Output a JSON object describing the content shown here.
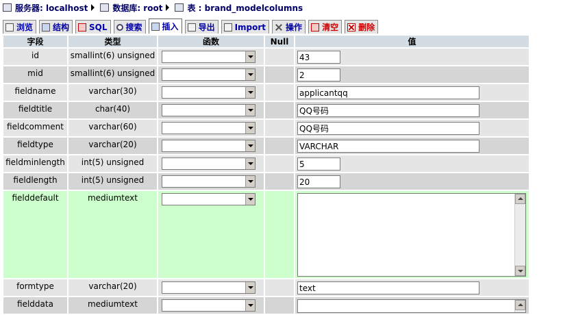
{
  "breadcrumb": {
    "server_label": "服务器: localhost",
    "database_label": "数据库: root",
    "table_label": "表 : brand_modelcolumns"
  },
  "tabs": [
    {
      "id": "browse",
      "label": "浏览",
      "icon": "browse-icon"
    },
    {
      "id": "structure",
      "label": "结构",
      "icon": "structure-icon"
    },
    {
      "id": "sql",
      "label": "SQL",
      "icon": "sql-icon"
    },
    {
      "id": "search",
      "label": "搜索",
      "icon": "search-icon"
    },
    {
      "id": "insert",
      "label": "插入",
      "icon": "insert-icon",
      "active": true
    },
    {
      "id": "export",
      "label": "导出",
      "icon": "export-icon"
    },
    {
      "id": "import",
      "label": "Import",
      "icon": "import-icon"
    },
    {
      "id": "operations",
      "label": "操作",
      "icon": "tools-icon"
    },
    {
      "id": "empty",
      "label": "清空",
      "icon": "empty-icon",
      "danger": true
    },
    {
      "id": "drop",
      "label": "删除",
      "icon": "drop-icon",
      "danger": true
    }
  ],
  "table": {
    "headers": {
      "field": "字段",
      "type": "类型",
      "function": "函数",
      "null": "Null",
      "value": "值"
    },
    "rows": [
      {
        "field": "id",
        "type": "smallint(6) unsigned",
        "value": "43"
      },
      {
        "field": "mid",
        "type": "smallint(6) unsigned",
        "value": "2"
      },
      {
        "field": "fieldname",
        "type": "varchar(30)",
        "value": "applicantqq"
      },
      {
        "field": "fieldtitle",
        "type": "char(40)",
        "value": "QQ号码"
      },
      {
        "field": "fieldcomment",
        "type": "varchar(60)",
        "value": "QQ号码"
      },
      {
        "field": "fieldtype",
        "type": "varchar(20)",
        "value": "VARCHAR"
      },
      {
        "field": "fieldminlength",
        "type": "int(5) unsigned",
        "value": "5"
      },
      {
        "field": "fieldlength",
        "type": "int(5) unsigned",
        "value": "20"
      },
      {
        "field": "fielddefault",
        "type": "mediumtext",
        "value": ""
      },
      {
        "field": "formtype",
        "type": "varchar(20)",
        "value": "text"
      },
      {
        "field": "fielddata",
        "type": "mediumtext",
        "value": ""
      }
    ]
  }
}
